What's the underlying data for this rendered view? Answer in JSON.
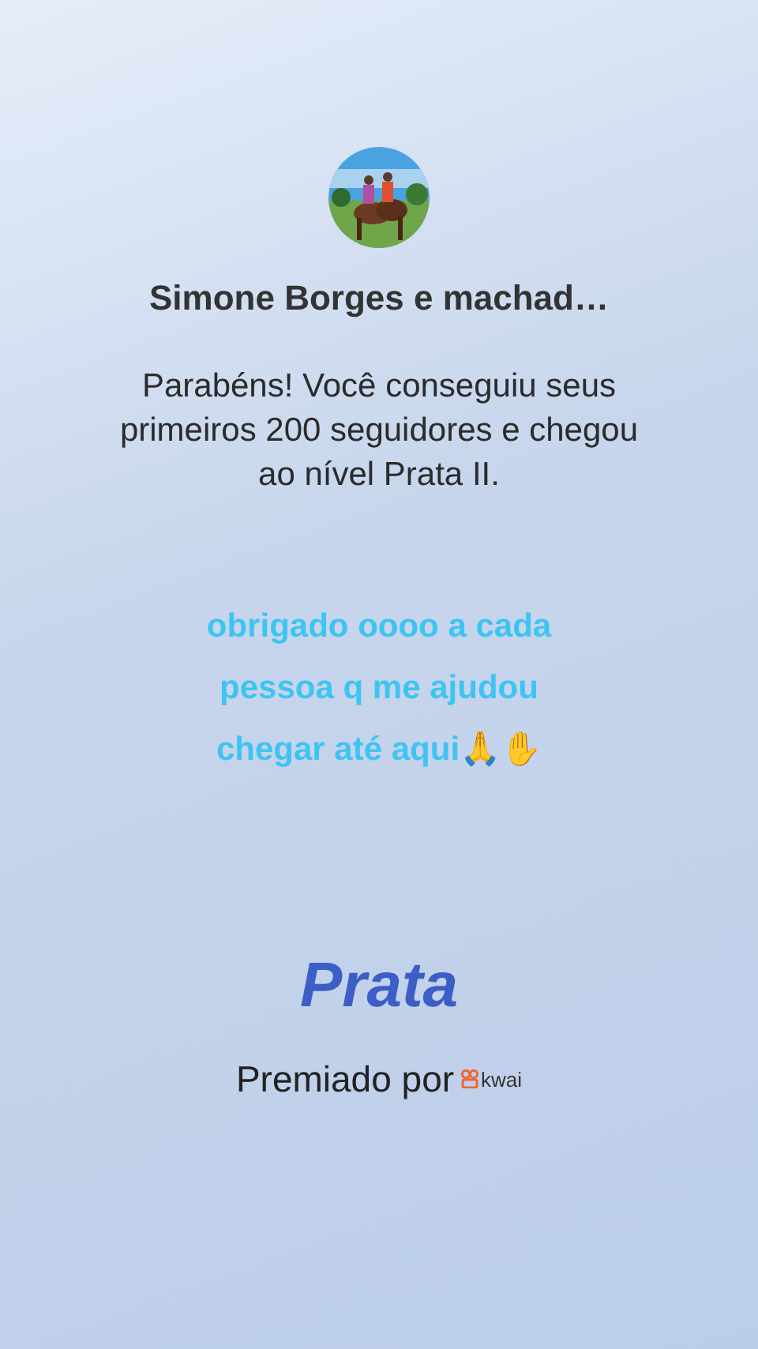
{
  "profile": {
    "name": "Simone Borges e machad…"
  },
  "message": "Parabéns! Você conseguiu seus primeiros 200 seguidores e chegou ao nível Prata II.",
  "caption": "obrigado oooo a cada pessoa q me ajudou chegar até aqui🙏✋",
  "level_title": "Prata",
  "awarded_by": {
    "label": "Premiado por",
    "brand": "kwai"
  }
}
